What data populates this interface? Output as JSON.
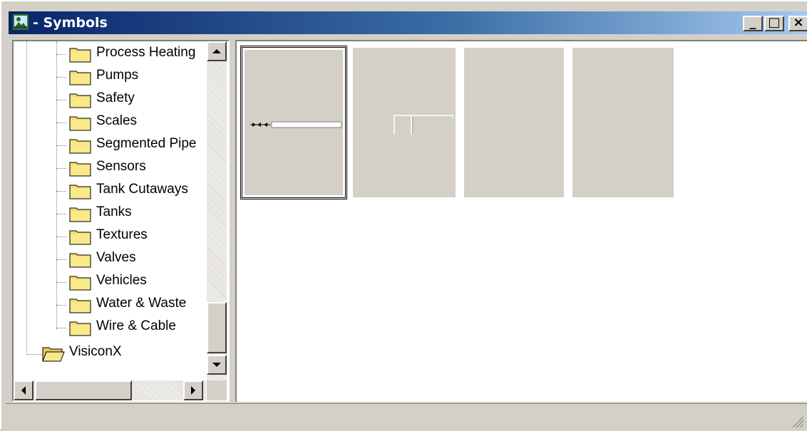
{
  "window": {
    "title": "- Symbols",
    "controls": {
      "minimize": "_",
      "maximize": "□",
      "close": "×"
    }
  },
  "tree": {
    "items": [
      {
        "label": "Process Heating",
        "icon": "folder-closed-icon"
      },
      {
        "label": "Pumps",
        "icon": "folder-closed-icon"
      },
      {
        "label": "Safety",
        "icon": "folder-closed-icon"
      },
      {
        "label": "Scales",
        "icon": "folder-closed-icon"
      },
      {
        "label": "Segmented Pipe",
        "icon": "folder-closed-icon"
      },
      {
        "label": "Sensors",
        "icon": "folder-closed-icon"
      },
      {
        "label": "Tank Cutaways",
        "icon": "folder-closed-icon"
      },
      {
        "label": "Tanks",
        "icon": "folder-closed-icon"
      },
      {
        "label": "Textures",
        "icon": "folder-closed-icon"
      },
      {
        "label": "Valves",
        "icon": "folder-closed-icon"
      },
      {
        "label": "Vehicles",
        "icon": "folder-closed-icon"
      },
      {
        "label": "Water & Waste",
        "icon": "folder-closed-icon"
      },
      {
        "label": "Wire & Cable",
        "icon": "folder-closed-icon"
      },
      {
        "label": "VisiconX",
        "icon": "folder-open-icon"
      }
    ]
  },
  "symbols": {
    "tiles": [
      {
        "name": "pipe-arrow-symbol",
        "selected": true
      },
      {
        "name": "pipe-tee-symbol",
        "selected": false
      },
      {
        "name": "blank-symbol",
        "selected": false
      },
      {
        "name": "blank-symbol",
        "selected": false
      }
    ]
  },
  "colors": {
    "titlebar_start": "#0a246a",
    "titlebar_end": "#a6caf0",
    "face": "#d4d0c8",
    "folder": "#f4dc6c"
  }
}
